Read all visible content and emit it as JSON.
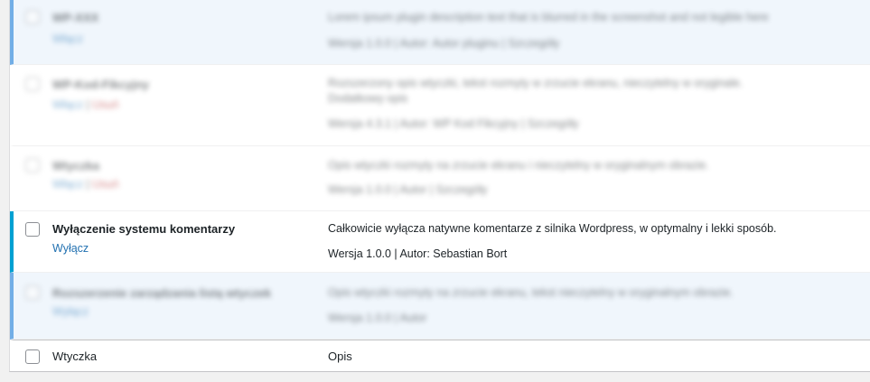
{
  "plugins": [
    {
      "name": "WP-XXX",
      "actions": [
        "Włącz"
      ],
      "description": "Lorem ipsum plugin description text that is blurred in the screenshot and not legible here",
      "meta": "Wersja 1.0.0 | Autor: Autor pluginu | Szczegóły"
    },
    {
      "name": "WP-Kod-Fikcyjny",
      "actions": [
        "Włącz",
        "Usuń"
      ],
      "description": "Rozszerzony opis wtyczki, tekst rozmyty w zrzucie ekranu, nieczytelny w oryginale.",
      "description2": "Dodatkowy opis",
      "meta": "Wersja 4.3.1 | Autor: WP Kod Fikcyjny | Szczegóły"
    },
    {
      "name": "Wtyczka",
      "actions": [
        "Włącz",
        "Usuń"
      ],
      "description": "Opis wtyczki rozmyty na zrzucie ekranu i nieczytelny w oryginalnym obrazie.",
      "meta": "Wersja 1.0.0 | Autor | Szczegóły"
    },
    {
      "name": "Wyłączenie systemu komentarzy",
      "actions": [
        "Wyłącz"
      ],
      "description": "Całkowicie wyłącza natywne komentarze z silnika Wordpress, w optymalny i lekki sposób.",
      "meta": "Wersja 1.0.0 | Autor: Sebastian Bort"
    },
    {
      "name": "Rozszerzenie zarządzania listą wtyczek",
      "actions": [
        "Wyłącz"
      ],
      "description": "Opis wtyczki rozmyty na zrzucie ekranu, tekst nieczytelny w oryginalnym obrazie.",
      "meta": "Wersja 1.0.0 | Autor"
    }
  ],
  "footer": {
    "column_plugin": "Wtyczka",
    "column_description": "Opis"
  },
  "colors": {
    "accent": "#00a0d2",
    "link": "#2271b1",
    "delete": "#b32d2e",
    "active_bg": "#f0f6fc"
  }
}
